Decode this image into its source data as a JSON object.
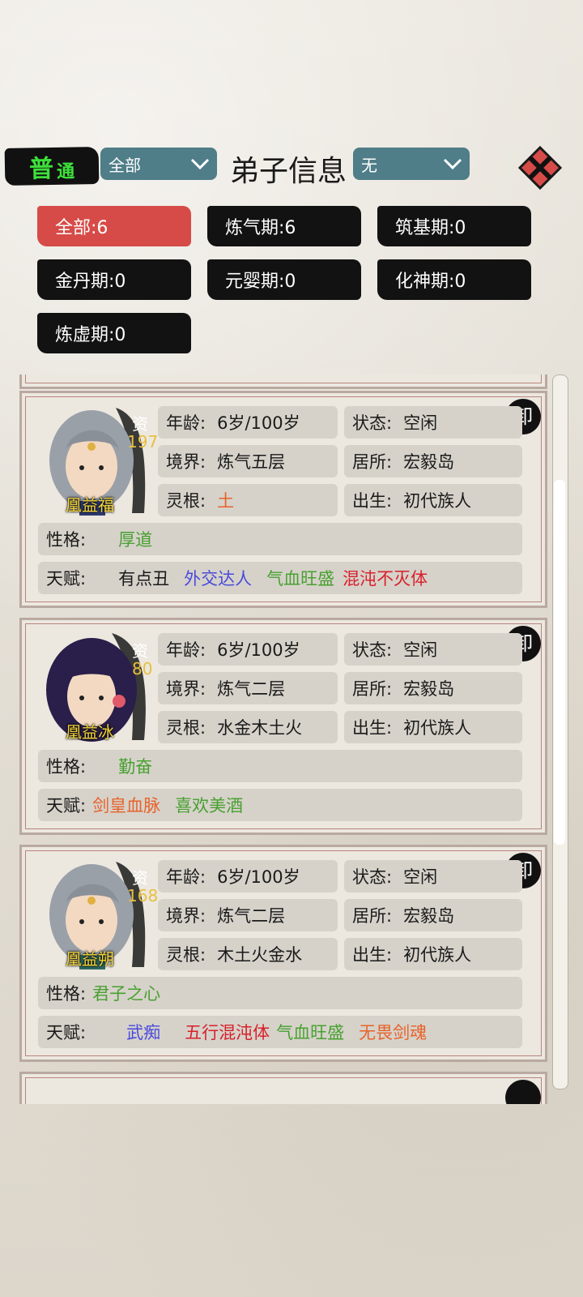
{
  "header": {
    "mode_char1": "普",
    "mode_char2": "通",
    "left_dropdown": "全部",
    "title": "弟子信息",
    "right_dropdown": "无"
  },
  "filters": [
    {
      "label": "全部:6",
      "active": true
    },
    {
      "label": "炼气期:6",
      "active": false
    },
    {
      "label": "筑基期:0",
      "active": false
    },
    {
      "label": "金丹期:0",
      "active": false
    },
    {
      "label": "元婴期:0",
      "active": false
    },
    {
      "label": "化神期:0",
      "active": false
    },
    {
      "label": "炼虚期:0",
      "active": false
    }
  ],
  "labels": {
    "aptitude": "资",
    "age": "年龄:",
    "status": "状态:",
    "realm": "境界:",
    "residence": "居所:",
    "root": "灵根:",
    "birth": "出生:",
    "personality": "性格:",
    "talent": "天赋:",
    "seal": "卸"
  },
  "colors": {
    "accent_red": "#d64b47",
    "orange": "#e8622a",
    "green": "#48a030",
    "blue": "#4a4adc",
    "red": "#d8202a",
    "gold": "#f4d53a"
  },
  "disciples": [
    {
      "name": "凰益福",
      "aptitude": "197",
      "age": "6岁/100岁",
      "status": "空闲",
      "realm": "炼气五层",
      "residence": "宏毅岛",
      "root": "土",
      "birth": "初代族人",
      "personality": "厚道",
      "talents": [
        "有点丑",
        "外交达人",
        "气血旺盛",
        "混沌不灭体"
      ]
    },
    {
      "name": "凰益冰",
      "aptitude": "80",
      "age": "6岁/100岁",
      "status": "空闲",
      "realm": "炼气二层",
      "residence": "宏毅岛",
      "root": "水金木土火",
      "birth": "初代族人",
      "personality": "勤奋",
      "talents": [
        "剑皇血脉",
        "喜欢美酒"
      ]
    },
    {
      "name": "凰益朔",
      "aptitude": "168",
      "age": "6岁/100岁",
      "status": "空闲",
      "realm": "炼气二层",
      "residence": "宏毅岛",
      "root": "木土火金水",
      "birth": "初代族人",
      "personality": "君子之心",
      "talents": [
        "武痴",
        "五行混沌体",
        "气血旺盛",
        "无畏剑魂"
      ]
    }
  ]
}
